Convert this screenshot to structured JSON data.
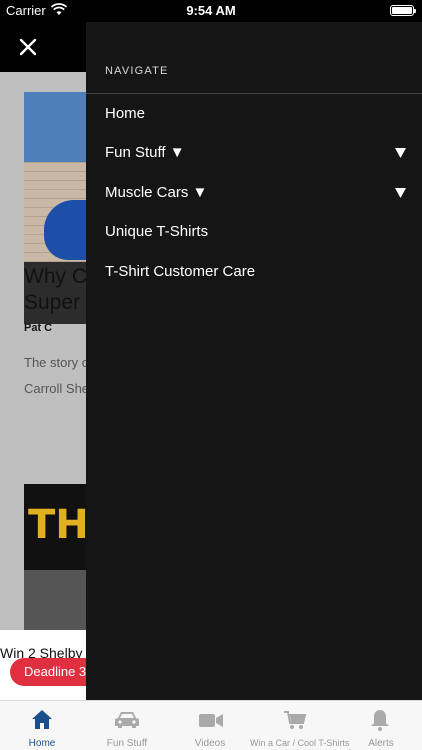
{
  "status_bar": {
    "carrier": "Carrier",
    "time": "9:54 AM"
  },
  "background": {
    "article_title": "Why C\nSuper",
    "author": "Pat C",
    "excerpt_lines": [
      "The story o",
      "Carroll She"
    ],
    "thumb_text": "TH",
    "promo_text": "Win 2 Shelby",
    "deadline": "Deadline 3/"
  },
  "drawer": {
    "heading": "NAVIGATE",
    "items": [
      {
        "label": "Home"
      },
      {
        "label": "Fun Stuff ▼"
      },
      {
        "label": "Muscle Cars ▼"
      },
      {
        "label": "Unique T-Shirts"
      },
      {
        "label": "T-Shirt Customer Care"
      }
    ]
  },
  "tab_bar": {
    "tabs": [
      {
        "label": "Home",
        "icon": "home-icon"
      },
      {
        "label": "Fun Stuff",
        "icon": "car-icon"
      },
      {
        "label": "Videos",
        "icon": "video-camera-icon"
      },
      {
        "label": "Win a Car / Cool T-Shirts",
        "icon": "cart-icon"
      },
      {
        "label": "Alerts",
        "icon": "bell-icon"
      }
    ]
  },
  "colors": {
    "accent": "#1a4f8b",
    "drawer_bg": "#151515",
    "deadline_red": "#e03040"
  }
}
